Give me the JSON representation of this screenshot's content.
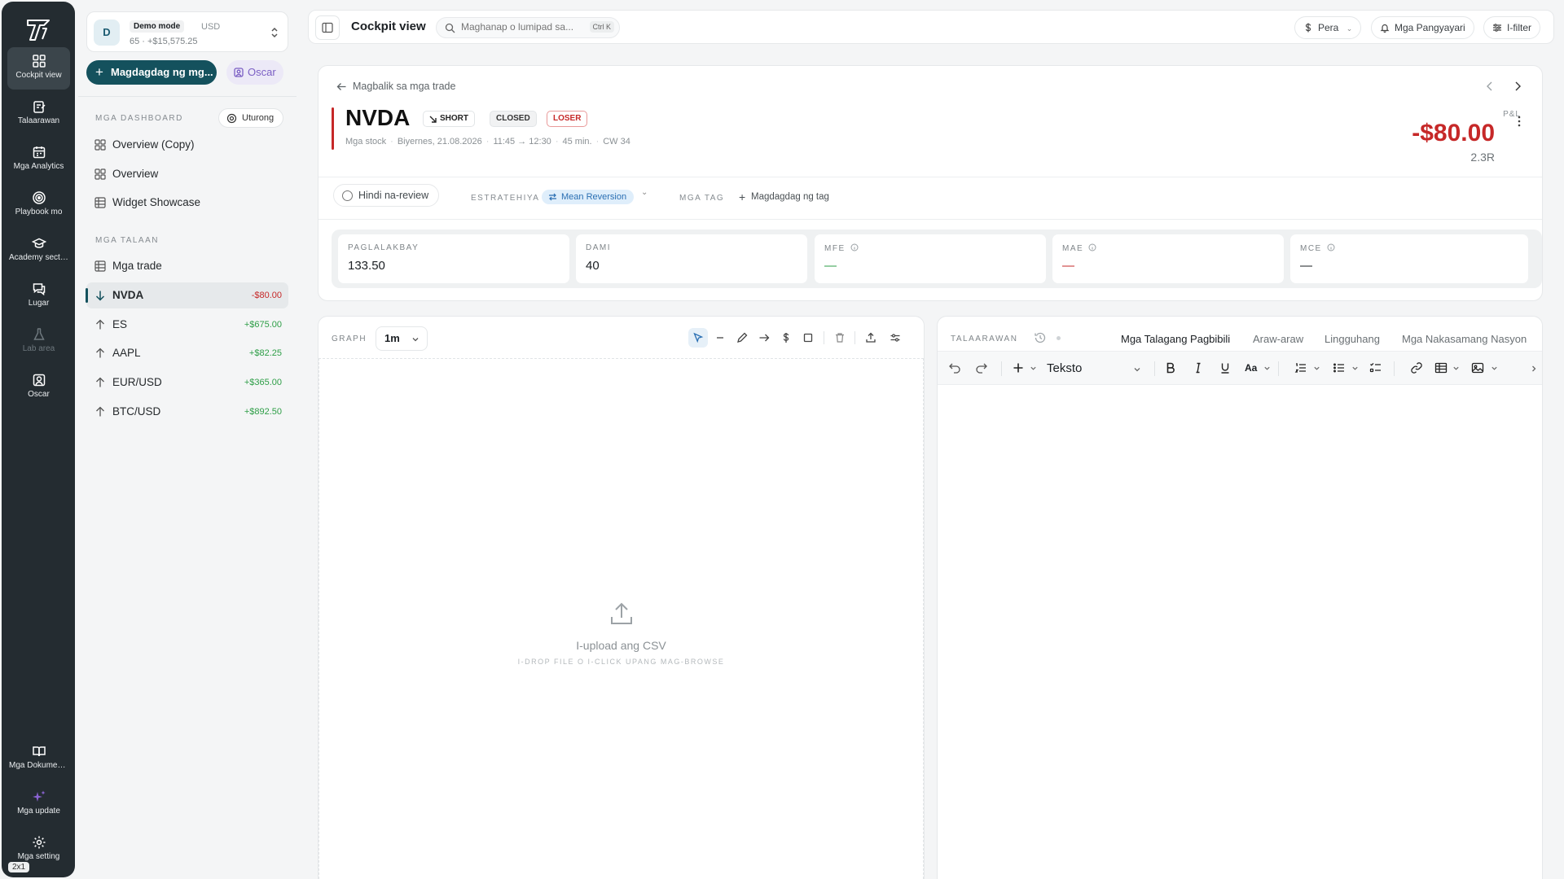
{
  "rail": {
    "items": [
      {
        "label": "Cockpit view"
      },
      {
        "label": "Talaarawan"
      },
      {
        "label": "Mga Analytics"
      },
      {
        "label": "Playbook mo"
      },
      {
        "label": "Academy secti..."
      },
      {
        "label": "Lugar"
      },
      {
        "label": "Lab area"
      },
      {
        "label": "Oscar"
      }
    ],
    "bottom": [
      {
        "label": "Mga Dokumen..."
      },
      {
        "label": "Mga update"
      },
      {
        "label": "Mga setting"
      }
    ],
    "badge": "2x1"
  },
  "account": {
    "avatar": "D",
    "mode": "Demo mode",
    "currency": "USD",
    "summary": "65 · +$15,575.25"
  },
  "sidebar": {
    "add_label": "Magdagdag ng mg...",
    "oscar_label": "Oscar",
    "dashboards_label": "MGA DASHBOARD",
    "setup_label": "Uturong",
    "dashboards": [
      {
        "label": "Overview (Copy)"
      },
      {
        "label": "Overview"
      },
      {
        "label": "Widget Showcase"
      }
    ],
    "journals_label": "MGA TALAAN",
    "trades_label": "Mga trade",
    "trades": [
      {
        "symbol": "NVDA",
        "pnl": "-$80.00"
      },
      {
        "symbol": "ES",
        "pnl": "+$675.00"
      },
      {
        "symbol": "AAPL",
        "pnl": "+$82.25"
      },
      {
        "symbol": "EUR/USD",
        "pnl": "+$365.00"
      },
      {
        "symbol": "BTC/USD",
        "pnl": "+$892.50"
      }
    ]
  },
  "topbar": {
    "title": "Cockpit view",
    "search_placeholder": "Maghanap o lumipad sa...",
    "shortcut": "Ctrl K",
    "currency_label": "Pera",
    "events_label": "Mga Pangyayari",
    "filter_label": "I-filter"
  },
  "trade": {
    "back_label": "Magbalik sa mga trade",
    "symbol": "NVDA",
    "direction": "SHORT",
    "status": "CLOSED",
    "result": "LOSER",
    "meta": [
      "Mga stock",
      "Biyernes, 21.08.2026",
      "11:45 → 12:30",
      "45 min.",
      "CW 34"
    ],
    "pnl_label": "P&L",
    "pnl": "-$80.00",
    "r_multiple": "2.3R",
    "review_label": "Hindi na-review",
    "strategy_label": "ESTRATEHIYA",
    "strategy": "Mean Reversion",
    "tags_label": "MGA TAG",
    "add_tag_label": "Magdagdag ng tag",
    "stats": [
      {
        "label": "PAGLALAKBAY",
        "value": "133.50"
      },
      {
        "label": "DAMI",
        "value": "40"
      },
      {
        "label": "MFE",
        "value": "—"
      },
      {
        "label": "MAE",
        "value": "—"
      },
      {
        "label": "MCE",
        "value": "—"
      }
    ]
  },
  "graph": {
    "label": "GRAPH",
    "timeframe": "1m",
    "upload_title": "I-upload ang CSV",
    "upload_sub": "I-DROP FILE O I-CLICK UPANG MAG-BROWSE"
  },
  "journal": {
    "label": "TALAARAWAN",
    "tabs": [
      {
        "label": "Mga Talagang Pagbibili"
      },
      {
        "label": "Araw-araw"
      },
      {
        "label": "Lingguhang"
      },
      {
        "label": "Mga Nakasamang Nasyon"
      }
    ],
    "format": "Teksto"
  },
  "colors": {
    "rail_bg": "#242c31",
    "primary": "#14515d",
    "loss": "#c62828",
    "gain": "#2e9e47",
    "oscar": "#7b5fc4",
    "strategy_chip": "#dfeefb"
  }
}
